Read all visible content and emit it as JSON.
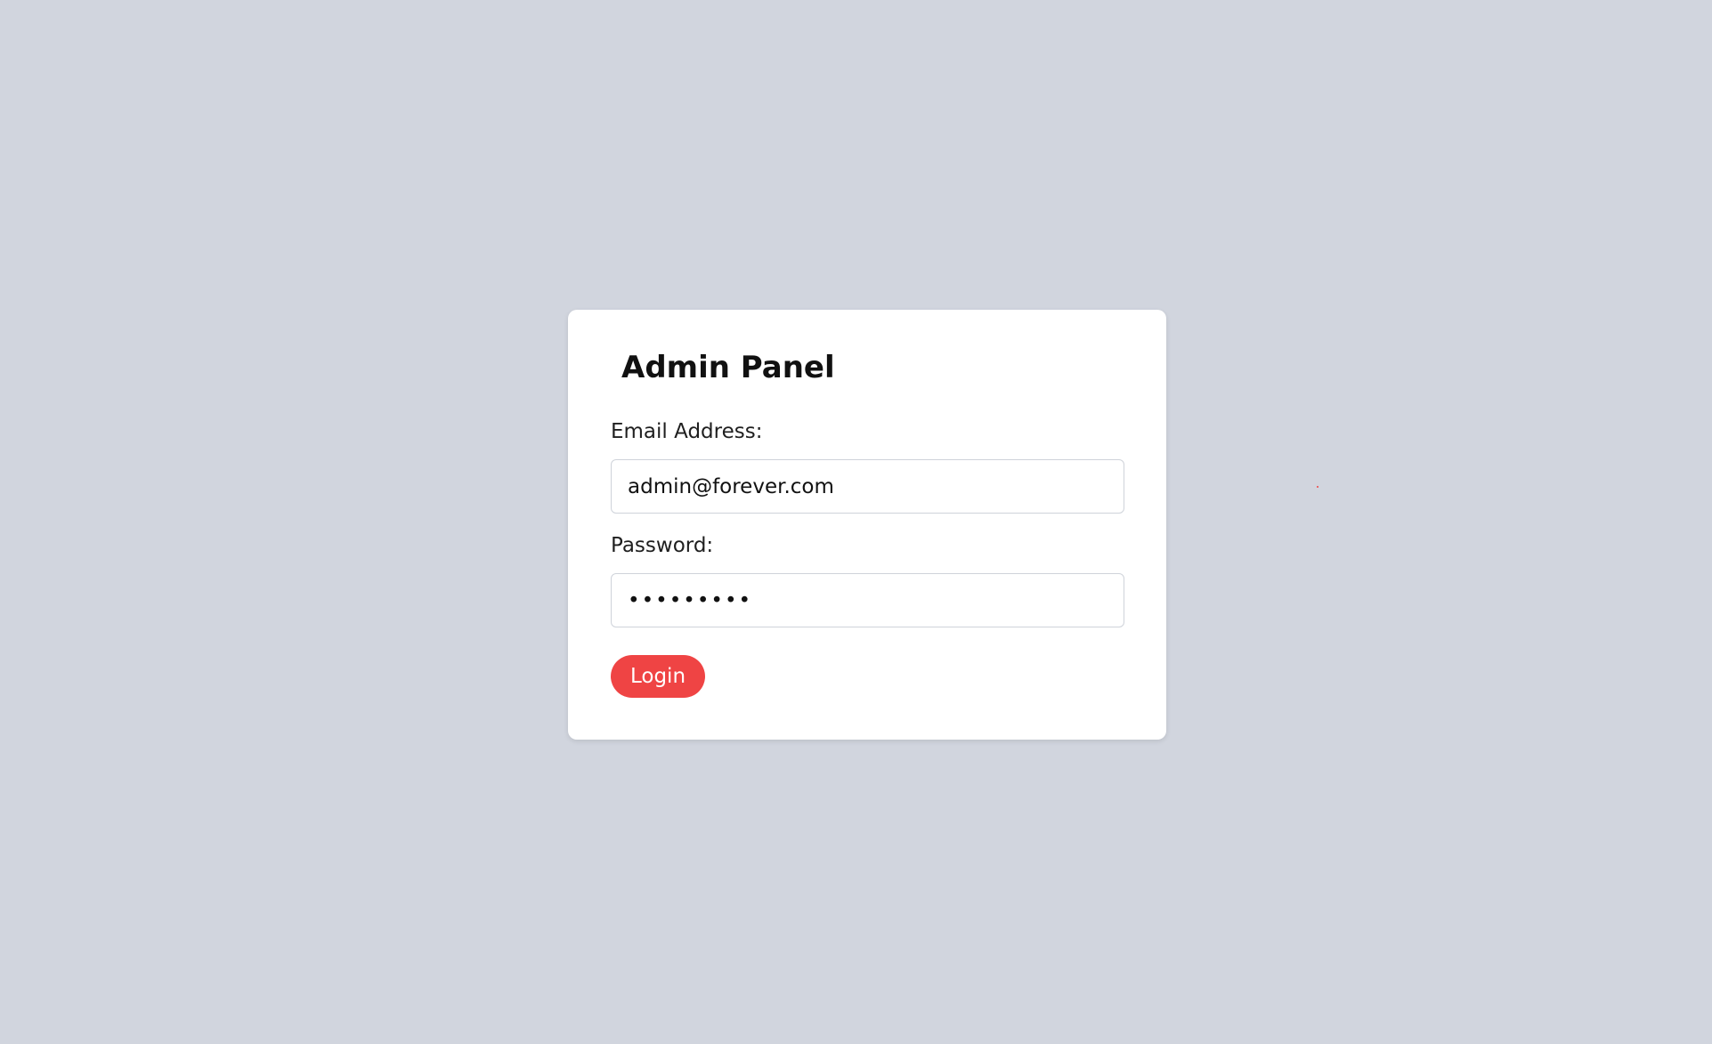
{
  "panel": {
    "title": "Admin Panel"
  },
  "form": {
    "email_label": "Email Address:",
    "email_value": "admin@forever.com",
    "password_label": "Password:",
    "password_value": "•••••••••",
    "login_label": "Login"
  },
  "colors": {
    "background": "#d1d5de",
    "card": "#ffffff",
    "accent": "#ef4444"
  }
}
